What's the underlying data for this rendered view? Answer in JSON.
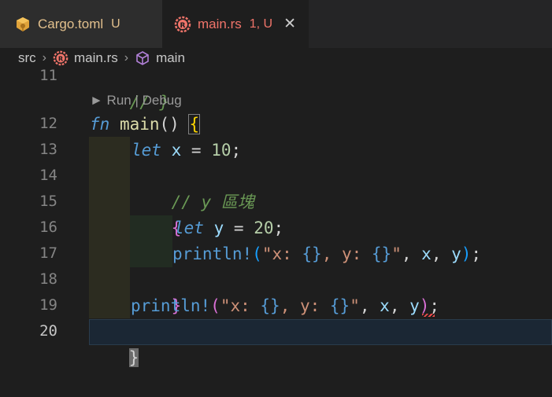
{
  "tabs": [
    {
      "name": "Cargo.toml",
      "status": "U"
    },
    {
      "name": "main.rs",
      "status": "1, U",
      "close": "✕"
    }
  ],
  "breadcrumb": {
    "items": [
      "src",
      "main.rs",
      "main"
    ],
    "separator": "›"
  },
  "codelens": "► Run | Debug",
  "line_numbers": [
    "11",
    "12",
    "13",
    "14",
    "15",
    "16",
    "17",
    "18",
    "19",
    "20"
  ],
  "code": {
    "l11": "// }",
    "l12": {
      "kw": "fn",
      "name": "main",
      "parens": "()",
      "brace": "{"
    },
    "l13": {
      "kw": "let",
      "var": "x",
      "eq": " = ",
      "num": "10",
      "semi": ";"
    },
    "l14": "// y 區塊",
    "l15": "{",
    "l16": {
      "kw": "let",
      "var": "y",
      "eq": " = ",
      "num": "20",
      "semi": ";"
    },
    "l17": {
      "macro": "println!",
      "open": "(",
      "q1": "\"x: ",
      "f1": "{}",
      "mid": ", y: ",
      "f2": "{}",
      "q2": "\"",
      "comma1": ", ",
      "a1": "x",
      "comma2": ", ",
      "a2": "y",
      "close": ")",
      "semi": ";"
    },
    "l18": "}",
    "l19": {
      "macro": "println!",
      "open": "(",
      "q1": "\"x: ",
      "f1": "{}",
      "mid": ", y: ",
      "f2": "{}",
      "q2": "\"",
      "comma1": ", ",
      "a1": "x",
      "comma2": ", ",
      "a2": "y",
      "close": ")",
      "semi": ";"
    },
    "l20": "}"
  },
  "colors": {
    "accent_error": "#f14c4c",
    "untracked": "#e2c08d",
    "tab_active_text": "#f0746a"
  },
  "icons": [
    "rust-cargo-icon",
    "rust-file-icon",
    "function-cube-icon",
    "close-icon"
  ]
}
